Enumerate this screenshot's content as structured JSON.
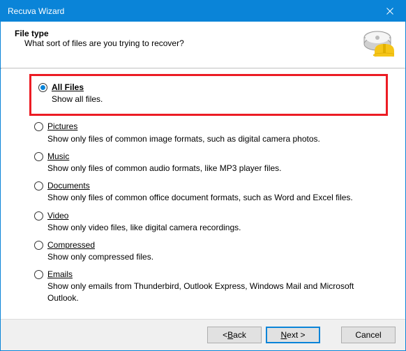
{
  "titlebar": {
    "title": "Recuva Wizard"
  },
  "header": {
    "title": "File type",
    "subtitle": "What sort of files are you trying to recover?"
  },
  "options": [
    {
      "label": "All Files",
      "desc": "Show all files.",
      "selected": true,
      "highlighted": true
    },
    {
      "label": "Pictures",
      "desc": "Show only files of common image formats, such as digital camera photos.",
      "selected": false
    },
    {
      "label": "Music",
      "desc": "Show only files of common audio formats, like MP3 player files.",
      "selected": false
    },
    {
      "label": "Documents",
      "desc": "Show only files of common office document formats, such as Word and Excel files.",
      "selected": false
    },
    {
      "label": "Video",
      "desc": "Show only video files, like digital camera recordings.",
      "selected": false
    },
    {
      "label": "Compressed",
      "desc": "Show only compressed files.",
      "selected": false
    },
    {
      "label": "Emails",
      "desc": "Show only emails from Thunderbird, Outlook Express, Windows Mail and Microsoft Outlook.",
      "selected": false
    }
  ],
  "buttons": {
    "back": "< Back",
    "next": "Next >",
    "cancel": "Cancel"
  },
  "colors": {
    "accent": "#0a84d8",
    "highlight": "#ec1c24"
  }
}
